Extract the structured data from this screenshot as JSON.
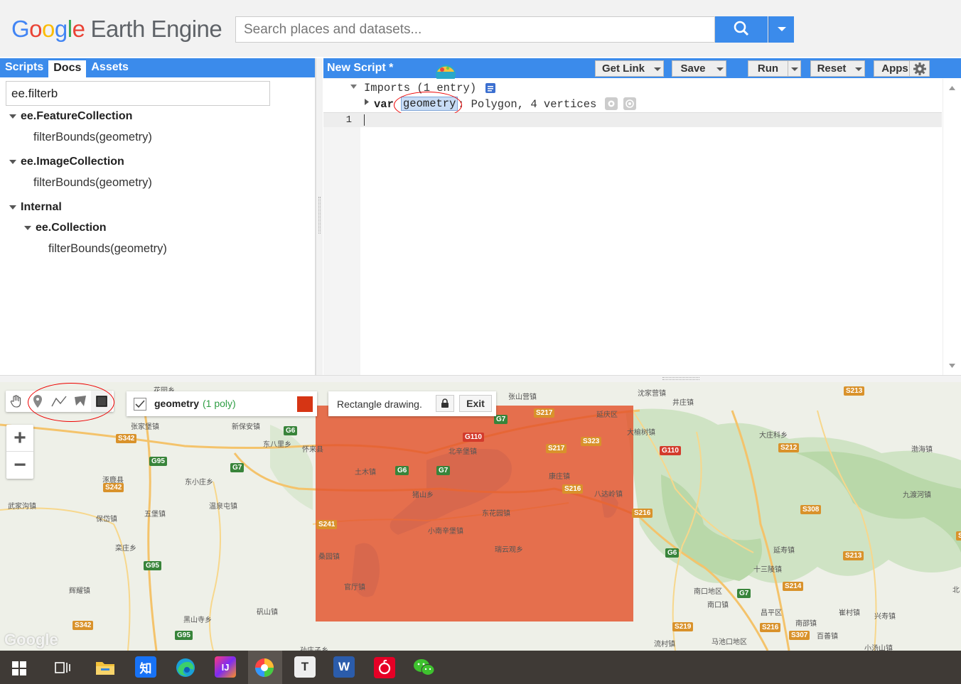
{
  "header": {
    "logo_google": [
      "G",
      "o",
      "o",
      "g",
      "l",
      "e"
    ],
    "logo_rest": "Earth Engine",
    "search_placeholder": "Search places and datasets..."
  },
  "left_panel": {
    "tabs": [
      {
        "label": "Scripts",
        "active": false
      },
      {
        "label": "Docs",
        "active": true
      },
      {
        "label": "Assets",
        "active": false
      }
    ],
    "docs_search_value": "ee.filterb",
    "tree": {
      "n1": "ee.FeatureCollection",
      "n1_leaf": "filterBounds(geometry)",
      "n2": "ee.ImageCollection",
      "n2_leaf": "filterBounds(geometry)",
      "n3": "Internal",
      "n3_child": "ee.Collection",
      "n3_child_leaf": "filterBounds(geometry)"
    }
  },
  "editor": {
    "title": "New Script *",
    "buttons": {
      "get_link": "Get Link",
      "save": "Save",
      "run": "Run",
      "reset": "Reset",
      "apps": "Apps"
    },
    "imports_label": "Imports (1 entry)",
    "var_keyword": "var",
    "var_name": "geometry",
    "var_desc": ": Polygon, 4 vertices",
    "line_number": "1"
  },
  "map": {
    "layer_checked": true,
    "layer_name": "geometry",
    "layer_count": "(1 poly)",
    "layer_color": "#d63514",
    "drawing_mode": "Rectangle drawing.",
    "exit_label": "Exit",
    "zoom_in": "+",
    "zoom_out": "−",
    "watermark": "Google",
    "labels": {
      "l1": "花园乡",
      "l2": "张家堡镇",
      "l3": "新保安镇",
      "l4": "东八里乡",
      "l5": "怀来县",
      "l6": "涿鹿县",
      "l7": "东小庄乡",
      "l8": "武家沟镇",
      "l9": "五堡镇",
      "l10": "温泉屯镇",
      "l11": "保岱镇",
      "l12": "栾庄乡",
      "l13": "辉耀镇",
      "l14": "黑山寺乡",
      "l15": "矾山镇",
      "l16": "孙庄子乡",
      "l17": "张山营镇",
      "l18": "沈家营镇",
      "l19": "井庄镇",
      "l20": "延庆区",
      "l21": "大榆树镇",
      "l22": "大庄科乡",
      "l23": "渤海镇",
      "l24": "北辛堡镇",
      "l25": "土木镇",
      "l26": "康庄镇",
      "l27": "八达岭镇",
      "l28": "九渡河镇",
      "l29": "猪山乡",
      "l30": "东花园镇",
      "l31": "小南辛堡镇",
      "l32": "瑞云观乡",
      "l33": "延寿镇",
      "l34": "十三陵镇",
      "l35": "桑园镇",
      "l36": "官厅镇",
      "l37": "南口地区",
      "l38": "南口镇",
      "l39": "昌平区",
      "l40": "崔村镇",
      "l41": "兴寿镇",
      "l42": "南邵镇",
      "l43": "百善镇",
      "l44": "流村镇",
      "l45": "马池口地区",
      "l46": "小汤山镇",
      "l47": "北"
    },
    "shields": {
      "s1": "S342",
      "s2": "G6",
      "s3": "G95",
      "s4": "G7",
      "s5": "S242",
      "s6": "G95",
      "s7": "S342",
      "s8": "G95",
      "s9": "S217",
      "s10": "G7",
      "s11": "G110",
      "s12": "S217",
      "s13": "S323",
      "s14": "G6",
      "s15": "G7",
      "s16": "S216",
      "s17": "S241",
      "s18": "S216",
      "s19": "G110",
      "s20": "S212",
      "s21": "S213",
      "s22": "S308",
      "s23": "G6",
      "s24": "S213",
      "s25": "S214",
      "s26": "G7",
      "s27": "S219",
      "s28": "S216",
      "s29": "S307",
      "s30": "S"
    }
  },
  "taskbar": {
    "zhihu": "知",
    "typora": "T",
    "word": "W",
    "idea": "IJ"
  }
}
